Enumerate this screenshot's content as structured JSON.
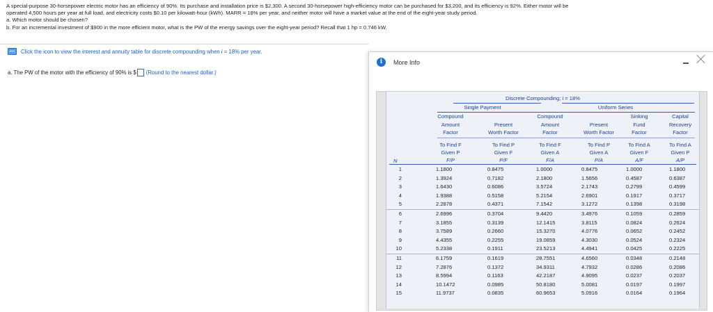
{
  "problem": {
    "line1": "A special-purpose 30-horsepower electric motor has an efficiency of 90%. Its purchase and installation price is $2,300. A second 30-horsepower high-efficiency motor can be purchased for $3,200, and its efficiency is 92%. Either motor will be",
    "line2": "operated 4,500 hours per year at full load, and electricity costs $0.10 per kilowatt-hour (kWh). MARR = 18% per year, and neither motor will have a market value at the end of the eight-year study period.",
    "line3": "a. Which motor should be chosen?",
    "line4": "b. For an incremental investment of $900 in the more efficient motor, what is the PW of the energy savings over the eight-year period? Recall that 1 hp = 0.746 kW."
  },
  "hint": {
    "prefix": "Click the icon to view the interest and annuity table for discrete compounding when ",
    "var": "i",
    "suffix": " = 18% per year."
  },
  "question": {
    "prefix": "a. The PW of the motor with the efficiency of 90% is $",
    "hint": "(Round to the nearest dollar.)"
  },
  "modal": {
    "title": "More Info",
    "info_icon": "i",
    "table": {
      "title": "Discrete Compounding; i = 18%",
      "group_single": "Single Payment",
      "group_uniform": "Uniform Series",
      "headers": [
        {
          "l1": "Compound",
          "l2": "Amount",
          "l3": "Factor",
          "s1": "To Find F",
          "s2": "Given P",
          "s3": "F/P"
        },
        {
          "l1": "",
          "l2": "Present",
          "l3": "Worth Factor",
          "s1": "To Find P",
          "s2": "Given F",
          "s3": "P/F"
        },
        {
          "l1": "Compound",
          "l2": "Amount",
          "l3": "Factor",
          "s1": "To Find F",
          "s2": "Given A",
          "s3": "F/A"
        },
        {
          "l1": "",
          "l2": "Present",
          "l3": "Worth Factor",
          "s1": "To Find P",
          "s2": "Given A",
          "s3": "P/A"
        },
        {
          "l1": "Sinking",
          "l2": "Fund",
          "l3": "Factor",
          "s1": "To Find A",
          "s2": "Given F",
          "s3": "A/F"
        },
        {
          "l1": "Capital",
          "l2": "Recovery",
          "l3": "Factor",
          "s1": "To Find A",
          "s2": "Given P",
          "s3": "A/P"
        }
      ],
      "n_label": "N",
      "rows": [
        [
          "1",
          "1.1800",
          "0.8475",
          "1.0000",
          "0.8475",
          "1.0000",
          "1.1800"
        ],
        [
          "2",
          "1.3924",
          "0.7182",
          "2.1800",
          "1.5656",
          "0.4587",
          "0.6387"
        ],
        [
          "3",
          "1.6430",
          "0.6086",
          "3.5724",
          "2.1743",
          "0.2799",
          "0.4599"
        ],
        [
          "4",
          "1.9388",
          "0.5158",
          "5.2154",
          "2.6901",
          "0.1917",
          "0.3717"
        ],
        [
          "5",
          "2.2878",
          "0.4371",
          "7.1542",
          "3.1272",
          "0.1398",
          "0.3198"
        ],
        [
          "6",
          "2.6996",
          "0.3704",
          "9.4420",
          "3.4976",
          "0.1059",
          "0.2859"
        ],
        [
          "7",
          "3.1855",
          "0.3139",
          "12.1415",
          "3.8115",
          "0.0824",
          "0.2624"
        ],
        [
          "8",
          "3.7589",
          "0.2660",
          "15.3270",
          "4.0776",
          "0.0652",
          "0.2452"
        ],
        [
          "9",
          "4.4355",
          "0.2255",
          "19.0859",
          "4.3030",
          "0.0524",
          "0.2324"
        ],
        [
          "10",
          "5.2338",
          "0.1911",
          "23.5213",
          "4.4941",
          "0.0425",
          "0.2225"
        ],
        [
          "11",
          "6.1759",
          "0.1619",
          "28.7551",
          "4.6560",
          "0.0348",
          "0.2148"
        ],
        [
          "12",
          "7.2876",
          "0.1372",
          "34.9311",
          "4.7932",
          "0.0286",
          "0.2086"
        ],
        [
          "13",
          "8.5994",
          "0.1163",
          "42.2187",
          "4.9095",
          "0.0237",
          "0.2037"
        ],
        [
          "14",
          "10.1472",
          "0.0985",
          "50.8180",
          "5.0081",
          "0.0197",
          "0.1997"
        ],
        [
          "15",
          "11.9737",
          "0.0835",
          "60.9653",
          "5.0916",
          "0.0164",
          "0.1964"
        ]
      ]
    }
  },
  "icons": {
    "table_icon": "table-icon",
    "info": "info-icon",
    "minimize": "minimize-icon",
    "close": "close-icon"
  },
  "colors": {
    "link": "#1f5fc4",
    "table_text": "#1a3f95",
    "info_icon": "#1f6fd0"
  }
}
